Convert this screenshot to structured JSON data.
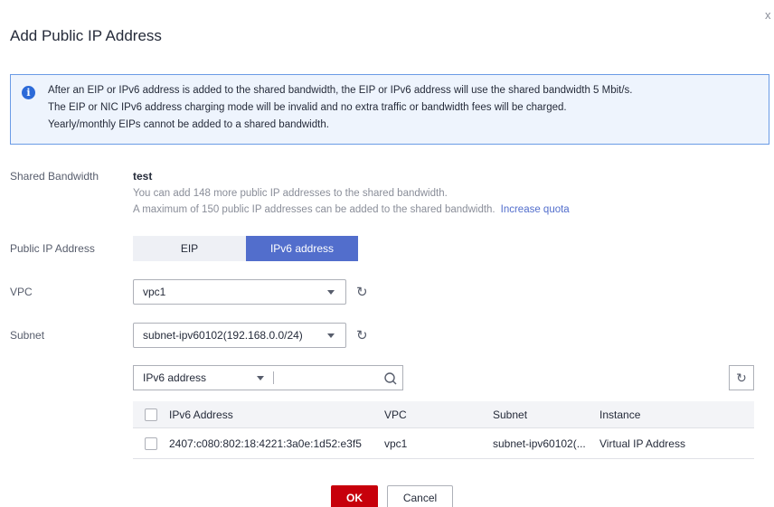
{
  "dialog": {
    "title": "Add Public IP Address",
    "close_glyph": "x"
  },
  "alert": {
    "icon": "info-icon",
    "lines": [
      "After an EIP or IPv6 address is added to the shared bandwidth, the EIP or IPv6 address will use the shared bandwidth 5 Mbit/s.",
      "The EIP or NIC IPv6 address charging mode will be invalid and no extra traffic or bandwidth fees will be charged.",
      "Yearly/monthly EIPs cannot be added to a shared bandwidth."
    ]
  },
  "shared_bandwidth": {
    "label": "Shared Bandwidth",
    "name": "test",
    "hint_1": "You can add 148 more public IP addresses to the shared bandwidth.",
    "hint_2": "A maximum of 150 public IP addresses can be added to the shared bandwidth.",
    "increase_quota": "Increase quota"
  },
  "public_ip": {
    "label": "Public IP Address",
    "options": [
      "EIP",
      "IPv6 address"
    ],
    "selected": "IPv6 address"
  },
  "vpc": {
    "label": "VPC",
    "value": "vpc1"
  },
  "subnet": {
    "label": "Subnet",
    "value": "subnet-ipv60102(192.168.0.0/24)"
  },
  "search": {
    "field": "IPv6 address",
    "value": ""
  },
  "table": {
    "columns": [
      "IPv6 Address",
      "VPC",
      "Subnet",
      "Instance"
    ],
    "rows": [
      [
        "2407:c080:802:18:4221:3a0e:1d52:e3f5",
        "vpc1",
        "subnet-ipv60102(...",
        "Virtual IP Address"
      ]
    ]
  },
  "footer": {
    "ok": "OK",
    "cancel": "Cancel"
  },
  "colors": {
    "primary": "#526ecc",
    "ok_button": "#c7000b",
    "alert_bg": "#eef4fd",
    "alert_border": "#6a9be6"
  }
}
